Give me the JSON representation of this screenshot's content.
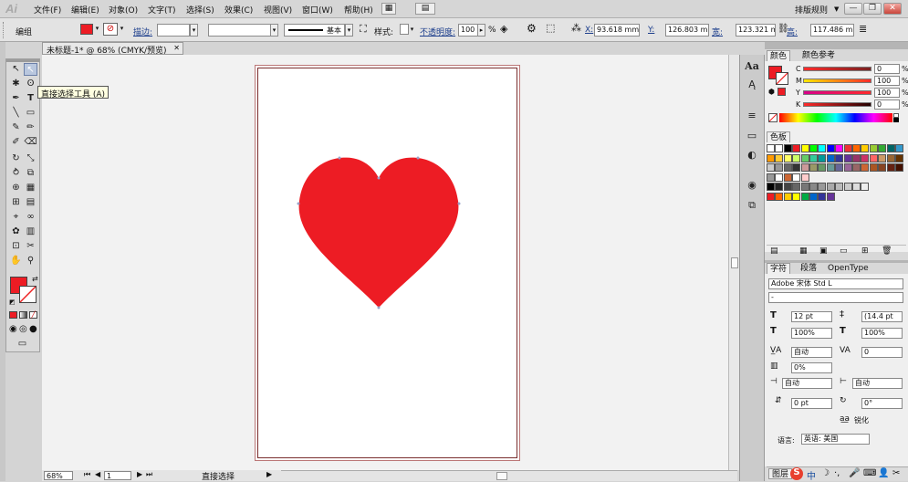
{
  "app": {
    "logo": "Ai"
  },
  "menu": [
    "文件(F)",
    "编辑(E)",
    "对象(O)",
    "文字(T)",
    "选择(S)",
    "效果(C)",
    "视图(V)",
    "窗口(W)",
    "帮助(H)"
  ],
  "workspace": {
    "label": "排版规则",
    "dropdown": "▼"
  },
  "window_buttons": {
    "minimize": "—",
    "restore": "❐",
    "close": "✕"
  },
  "control": {
    "selection_label": "编组",
    "fill_color": "#ed1c24",
    "stroke_label": "描边:",
    "stroke_profile": "基本",
    "style_label": "样式:",
    "opacity_label": "不透明度:",
    "opacity_value": "100",
    "opacity_unit": "%",
    "x_label": "X:",
    "x_value": "93.618 mm",
    "y_label": "Y:",
    "y_value": "126.803 mm",
    "w_label": "宽:",
    "w_value": "123.321 mi",
    "h_label": "高:",
    "h_value": "117.486 mm"
  },
  "document": {
    "tab_title": "未标题-1* @ 68% (CMYK/预览)",
    "tab_close": "✕",
    "heart_color": "#ed1c24"
  },
  "tooltip": "直接选择工具 (A)",
  "tools": {
    "selection": "↖",
    "direct_selection": "↖",
    "magic_wand": "✱",
    "lasso": "ʘ",
    "pen": "✒",
    "type": "T",
    "line": "╲",
    "rectangle": "▭",
    "brush": "✎",
    "pencil": "✏",
    "blob": "✐",
    "eraser": "⌫",
    "rotate": "↻",
    "scale": "⤡",
    "warp": "⥁",
    "free_transform": "⧉",
    "shape_builder": "⊕",
    "perspective": "▦",
    "mesh": "⊞",
    "gradient": "▤",
    "eyedropper": "⌖",
    "blend": "∞",
    "symbol": "✿",
    "column_graph": "▥",
    "artboard": "⊡",
    "slice": "✂",
    "hand": "✋",
    "zoom": "⚲",
    "screen_mode": "▭"
  },
  "panels": {
    "color_tab": "颜色",
    "color_guide_tab": "颜色参考",
    "c_label": "C",
    "c_value": "0",
    "m_label": "M",
    "m_value": "100",
    "y_label": "Y",
    "y_value": "100",
    "k_label": "K",
    "k_value": "0",
    "pct": "%",
    "swatches_tab": "色板",
    "char_tab": "字符",
    "para_tab": "段落",
    "opentype_tab": "OpenType",
    "font_family": "Adobe 宋体 Std L",
    "font_style": "-",
    "font_size": "12 pt",
    "leading": "(14.4 pt",
    "h_scale": "100%",
    "v_scale": "100%",
    "kerning": "自动",
    "tracking": "0",
    "tsume": "0%",
    "aki_left": "自动",
    "aki_right": "自动",
    "baseline": "0 pt",
    "rotation": "0°",
    "antialias": "锐化",
    "language_label": "语言:",
    "language": "英语: 美国"
  },
  "status": {
    "zoom": "68%",
    "page": "1",
    "tool_name": "直接选择",
    "layers_tab": "图层"
  },
  "taskbar": {
    "sogou": "S",
    "zh": "中"
  }
}
